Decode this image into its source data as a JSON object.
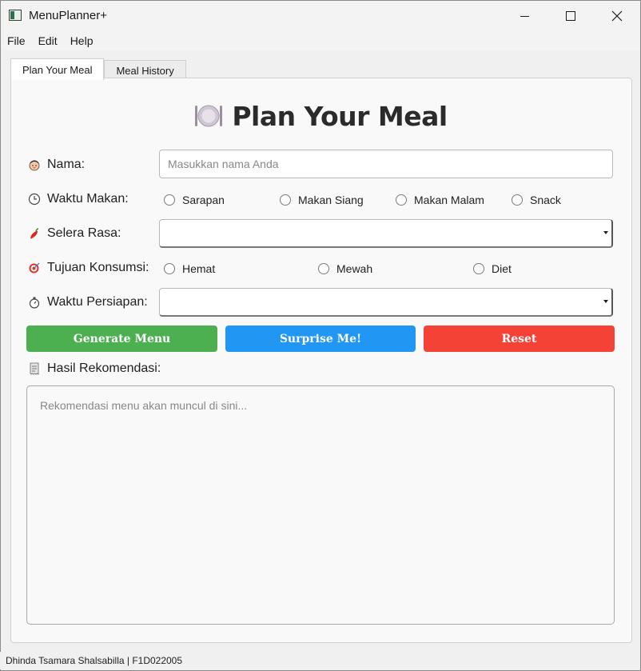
{
  "window": {
    "title": "MenuPlanner+"
  },
  "menubar": {
    "items": [
      "File",
      "Edit",
      "Help"
    ]
  },
  "tabs": [
    {
      "label": "Plan Your Meal",
      "active": true
    },
    {
      "label": "Meal History",
      "active": false
    }
  ],
  "form": {
    "heading": "Plan Your Meal",
    "heading_icon": "plate-cutlery-icon",
    "nama": {
      "label": "Nama:",
      "icon": "person-face-icon",
      "value": "",
      "placeholder": "Masukkan nama Anda"
    },
    "waktu_makan": {
      "label": "Waktu Makan:",
      "icon": "clock-icon",
      "options": [
        "Sarapan",
        "Makan Siang",
        "Makan Malam",
        "Snack"
      ]
    },
    "selera_rasa": {
      "label": "Selera Rasa:",
      "icon": "chili-pepper-icon",
      "value": ""
    },
    "tujuan_konsumsi": {
      "label": "Tujuan Konsumsi:",
      "icon": "target-icon",
      "options": [
        "Hemat",
        "Mewah",
        "Diet"
      ]
    },
    "waktu_persiapan": {
      "label": "Waktu Persiapan:",
      "icon": "stopwatch-icon",
      "value": ""
    },
    "buttons": {
      "generate": "Generate Menu",
      "surprise": "Surprise Me!",
      "reset": "Reset"
    },
    "hasil": {
      "label": "Hasil Rekomendasi:",
      "icon": "receipt-icon",
      "placeholder": "Rekomendasi menu akan muncul di sini..."
    }
  },
  "colors": {
    "generate": "#4caf50",
    "surprise": "#2196f3",
    "reset": "#f44336"
  },
  "statusbar": {
    "text": "Dhinda Tsamara Shalsabilla | F1D022005"
  }
}
